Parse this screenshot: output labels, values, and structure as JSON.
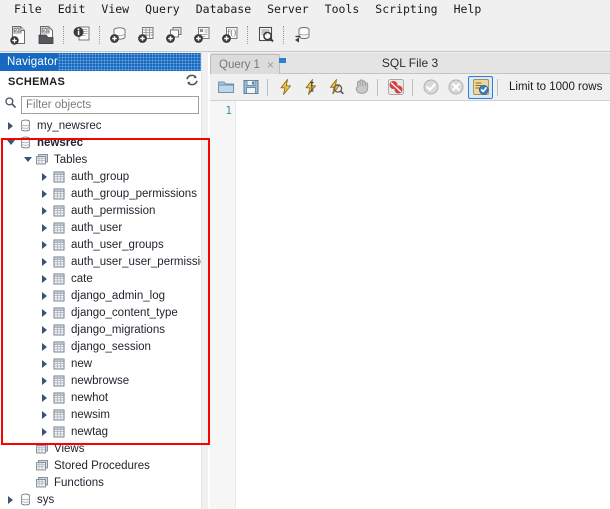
{
  "menubar": {
    "items": [
      {
        "label": "File"
      },
      {
        "label": "Edit"
      },
      {
        "label": "View"
      },
      {
        "label": "Query"
      },
      {
        "label": "Database"
      },
      {
        "label": "Server"
      },
      {
        "label": "Tools"
      },
      {
        "label": "Scripting"
      },
      {
        "label": "Help"
      }
    ]
  },
  "toolbar": {
    "buttons": [
      {
        "name": "new-sql-tab-icon",
        "title": "Create a new SQL tab for executing queries"
      },
      {
        "name": "open-sql-script-icon",
        "title": "Open a SQL script file in a new query tab"
      },
      {
        "name": "server-status-icon",
        "title": "Open Inspector for the selected object"
      },
      {
        "name": "new-schema-icon",
        "title": "Create a new schema in the connected server"
      },
      {
        "name": "new-table-icon",
        "title": "Create a new table in the active schema"
      },
      {
        "name": "new-view-icon",
        "title": "Create a new view in the active schema"
      },
      {
        "name": "new-procedure-icon",
        "title": "Create a new stored procedure in the active schema"
      },
      {
        "name": "new-function-icon",
        "title": "Create a new function in the active schema"
      },
      {
        "name": "search-data-icon",
        "title": "Search table data for text in objects"
      },
      {
        "name": "reconnect-server-icon",
        "title": "Reconnect to DBMS"
      }
    ]
  },
  "navigator": {
    "title": "Navigator",
    "schemas_label": "SCHEMAS",
    "refresh_icon": "refresh-icon",
    "search_icon": "search-icon",
    "filter_placeholder": "Filter objects",
    "filter_value": "",
    "tree": [
      {
        "label": "my_newsrec",
        "icon": "schema-icon",
        "indent": 0,
        "arrow": "right",
        "bold": false
      },
      {
        "label": "newsrec",
        "icon": "schema-icon",
        "indent": 0,
        "arrow": "down",
        "bold": true
      },
      {
        "label": "Tables",
        "icon": "folder-icon",
        "indent": 1,
        "arrow": "down",
        "bold": false
      },
      {
        "label": "auth_group",
        "icon": "table-icon",
        "indent": 2,
        "arrow": "right",
        "bold": false
      },
      {
        "label": "auth_group_permissions",
        "icon": "table-icon",
        "indent": 2,
        "arrow": "right",
        "bold": false
      },
      {
        "label": "auth_permission",
        "icon": "table-icon",
        "indent": 2,
        "arrow": "right",
        "bold": false
      },
      {
        "label": "auth_user",
        "icon": "table-icon",
        "indent": 2,
        "arrow": "right",
        "bold": false
      },
      {
        "label": "auth_user_groups",
        "icon": "table-icon",
        "indent": 2,
        "arrow": "right",
        "bold": false
      },
      {
        "label": "auth_user_user_permissions",
        "icon": "table-icon",
        "indent": 2,
        "arrow": "right",
        "bold": false
      },
      {
        "label": "cate",
        "icon": "table-icon",
        "indent": 2,
        "arrow": "right",
        "bold": false
      },
      {
        "label": "django_admin_log",
        "icon": "table-icon",
        "indent": 2,
        "arrow": "right",
        "bold": false
      },
      {
        "label": "django_content_type",
        "icon": "table-icon",
        "indent": 2,
        "arrow": "right",
        "bold": false
      },
      {
        "label": "django_migrations",
        "icon": "table-icon",
        "indent": 2,
        "arrow": "right",
        "bold": false
      },
      {
        "label": "django_session",
        "icon": "table-icon",
        "indent": 2,
        "arrow": "right",
        "bold": false
      },
      {
        "label": "new",
        "icon": "table-icon",
        "indent": 2,
        "arrow": "right",
        "bold": false
      },
      {
        "label": "newbrowse",
        "icon": "table-icon",
        "indent": 2,
        "arrow": "right",
        "bold": false
      },
      {
        "label": "newhot",
        "icon": "table-icon",
        "indent": 2,
        "arrow": "right",
        "bold": false
      },
      {
        "label": "newsim",
        "icon": "table-icon",
        "indent": 2,
        "arrow": "right",
        "bold": false
      },
      {
        "label": "newtag",
        "icon": "table-icon",
        "indent": 2,
        "arrow": "right",
        "bold": false
      },
      {
        "label": "Views",
        "icon": "folder-icon",
        "indent": 1,
        "arrow": "none",
        "bold": false
      },
      {
        "label": "Stored Procedures",
        "icon": "folder-icon",
        "indent": 1,
        "arrow": "none",
        "bold": false
      },
      {
        "label": "Functions",
        "icon": "folder-icon",
        "indent": 1,
        "arrow": "none",
        "bold": false
      },
      {
        "label": "sys",
        "icon": "schema-icon",
        "indent": 0,
        "arrow": "right",
        "bold": false
      }
    ]
  },
  "annotation": {
    "color": "#fb0000",
    "name": "red-highlight-rectangle"
  },
  "editor": {
    "tab_label": "Query 1",
    "tab_close": "×",
    "file_title": "SQL File 3",
    "toolbar": [
      {
        "name": "open-file-icon",
        "title": "Open a script file in this editor"
      },
      {
        "name": "save-file-icon",
        "title": "Save the script to a file"
      },
      {
        "name": "execute-icon",
        "title": "Execute the selected portion of the script or everything"
      },
      {
        "name": "execute-current-icon",
        "title": "Execute the statement under the keyboard cursor"
      },
      {
        "name": "explain-icon",
        "title": "Execute the EXPLAIN command on the statement under the cursor"
      },
      {
        "name": "stop-icon",
        "title": "Stop the query being executed"
      },
      {
        "name": "toggle-stop-icon",
        "title": "Toggle whether execution should stop or continue if errors occur"
      },
      {
        "name": "commit-icon",
        "title": "Commit the current transaction"
      },
      {
        "name": "rollback-icon",
        "title": "Rollback the current transaction"
      },
      {
        "name": "autocommit-icon",
        "title": "Toggle autocommit mode"
      }
    ],
    "limit_label": "Limit to 1000 rows",
    "line_numbers": [
      "1"
    ],
    "code_lines": [
      ""
    ]
  }
}
